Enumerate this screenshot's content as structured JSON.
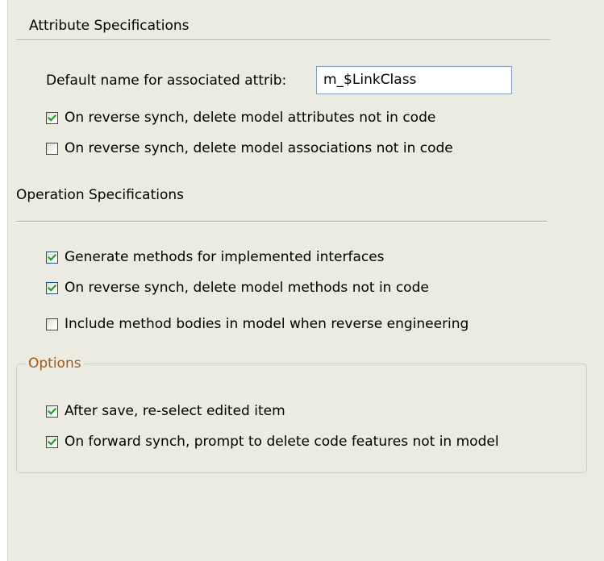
{
  "attribute_specifications": {
    "heading": "Attribute Specifications",
    "default_name_label": "Default name for associated attrib:",
    "default_name_value": "m_$LinkClass",
    "checkboxes": [
      {
        "label": "On reverse synch, delete model attributes not in code",
        "checked": true
      },
      {
        "label": "On reverse synch, delete model associations not in code",
        "checked": false
      }
    ]
  },
  "operation_specifications": {
    "heading": "Operation Specifications",
    "checkboxes": [
      {
        "label": "Generate methods for implemented interfaces",
        "checked": true
      },
      {
        "label": "On reverse synch, delete model methods not in code",
        "checked": true
      },
      {
        "label": "Include method bodies in model when reverse engineering",
        "checked": false
      }
    ]
  },
  "options": {
    "heading": "Options",
    "heading_color": "#9c5a1c",
    "checkboxes": [
      {
        "label": "After save, re-select edited item",
        "checked": true
      },
      {
        "label": "On forward synch, prompt to delete code features not in model",
        "checked": true
      }
    ]
  },
  "colors": {
    "panel_background": "#ecebe2",
    "checkbox_border": "#1c5180",
    "checkmark": "#21a121",
    "textfield_border": "#7f9db9"
  }
}
